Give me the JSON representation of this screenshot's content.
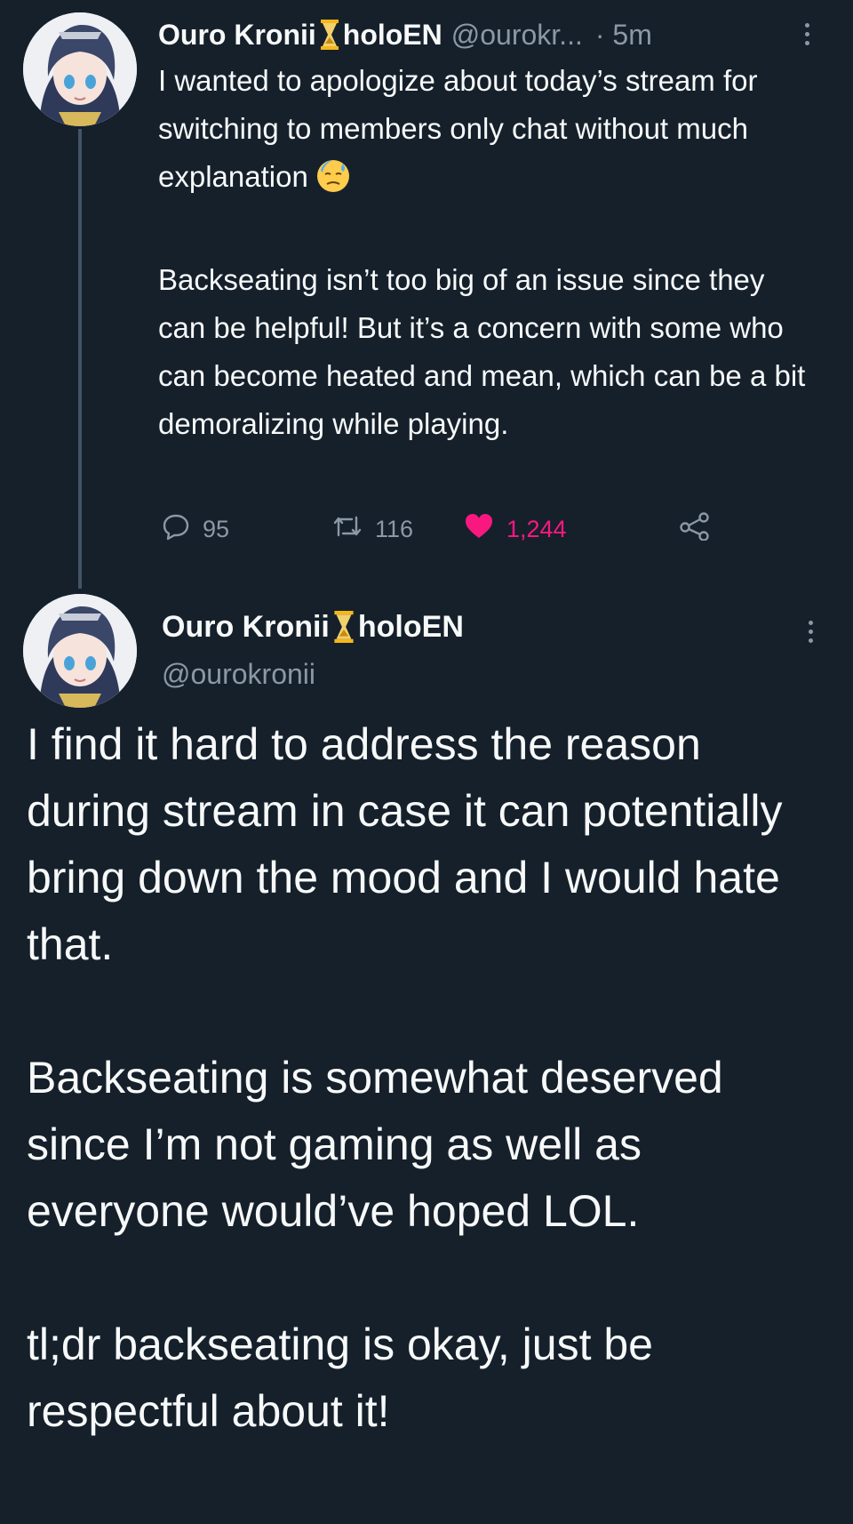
{
  "tweet1": {
    "display_name": "Ouro Kronii",
    "suffix": "holoEN",
    "handle": "@ourokr...",
    "time": "· 5m",
    "paragraphs": [
      "I wanted to apologize about today’s stream for switching to members only chat without much explanation",
      "Backseating isn’t too big of an issue since they can be helpful! But it’s a concern with some who can become heated and mean, which can be a bit demoralizing while playing."
    ],
    "reply_count": "95",
    "retweet_count": "116",
    "like_count": "1,244"
  },
  "tweet2": {
    "display_name": "Ouro Kronii",
    "suffix": "holoEN",
    "handle": "@ourokronii",
    "paragraphs": [
      "I find it hard to address the reason during stream in case it can potentially bring down the mood and I would hate that.",
      "Backseating is somewhat deserved since I’m not gaming as well as everyone would’ve hoped LOL.",
      "tl;dr backseating is okay, just be respectful about it!"
    ]
  },
  "colors": {
    "background": "#15202b",
    "text": "#f7f9f9",
    "muted": "#8b98a5",
    "like": "#f91880",
    "hourglass": "#f5b81a"
  },
  "icons": [
    "hourglass-icon",
    "sweat-emoji-icon",
    "reply-icon",
    "retweet-icon",
    "heart-icon",
    "share-icon",
    "more-icon"
  ]
}
